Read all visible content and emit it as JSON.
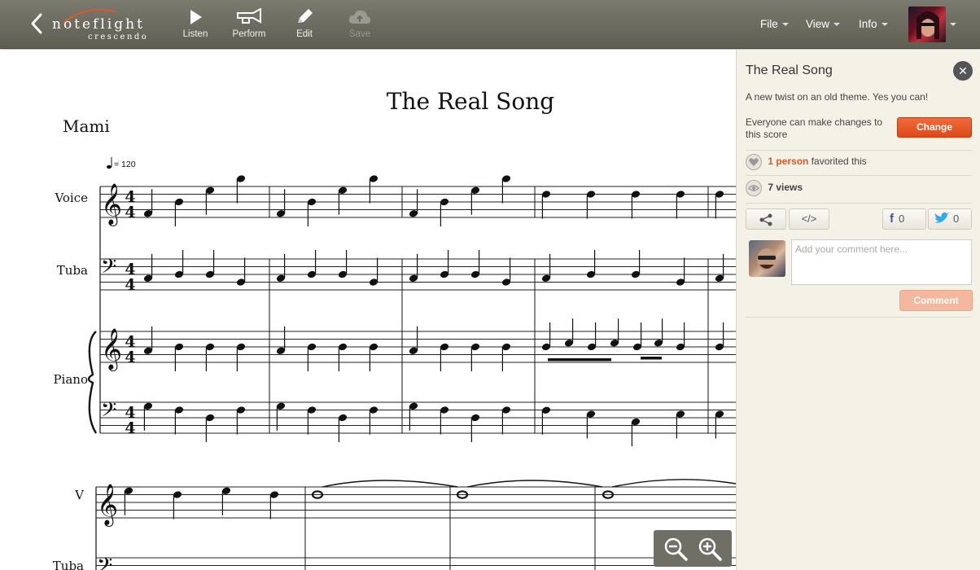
{
  "app": {
    "logo_name": "noteflight",
    "logo_sub": "crescendo"
  },
  "toolbar": {
    "listen": "Listen",
    "perform": "Perform",
    "edit": "Edit",
    "save": "Save"
  },
  "menus": {
    "file": "File",
    "view": "View",
    "info": "Info"
  },
  "score": {
    "title": "The Real Song",
    "composer": "Mami",
    "tempo": "= 120",
    "time_sig": "4",
    "instruments": [
      "Voice",
      "Tuba",
      "Piano"
    ],
    "abbrev_voice": "V",
    "abbrev_tuba": "Tuba"
  },
  "panel": {
    "title": "The Real Song",
    "description": "A new twist on an old theme. Yes you can!",
    "edit_permission": "Everyone can make changes to this score",
    "change_button": "Change",
    "favorites_count": "1 person",
    "favorites_suffix": "favorited this",
    "views": "7 views",
    "embed_label": "</>",
    "facebook_count": "0",
    "twitter_count": "0",
    "comment_placeholder": "Add your comment here...",
    "comment_button": "Comment"
  },
  "colors": {
    "accent": "#e0582a",
    "toolbar": "#6b6b60",
    "panel_bg": "#f4f1e6"
  }
}
